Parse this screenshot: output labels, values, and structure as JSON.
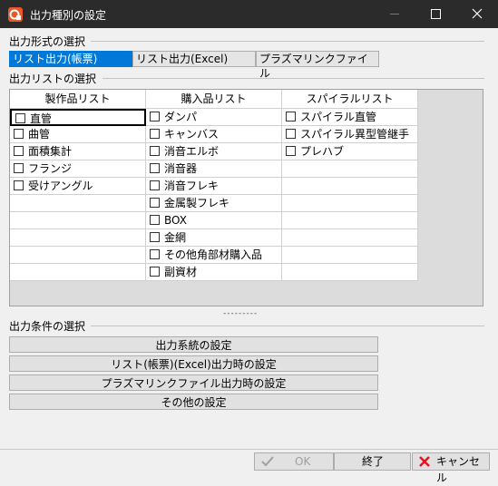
{
  "window": {
    "title": "出力種別の設定"
  },
  "output_format": {
    "heading": "出力形式の選択",
    "tabs": [
      {
        "label": "リスト出力(帳票)",
        "selected": true
      },
      {
        "label": "リスト出力(Excel)",
        "selected": false
      },
      {
        "label": "プラズマリンクファイル",
        "selected": false
      }
    ]
  },
  "output_list": {
    "heading": "出力リストの選択",
    "columns": [
      {
        "header": "製作品リスト",
        "items": [
          "直管",
          "曲管",
          "面積集計",
          "フランジ",
          "受けアングル"
        ]
      },
      {
        "header": "購入品リスト",
        "items": [
          "ダンパ",
          "キャンバス",
          "消音エルボ",
          "消音器",
          "消音フレキ",
          "金属製フレキ",
          "BOX",
          "金網",
          "その他角部材購入品",
          "副資材"
        ]
      },
      {
        "header": "スパイラルリスト",
        "items": [
          "スパイラル直管",
          "スパイラル異型管継手",
          "プレハブ"
        ]
      }
    ],
    "splitter": "---------"
  },
  "output_conditions": {
    "heading": "出力条件の選択",
    "buttons": [
      "出力系統の設定",
      "リスト(帳票)(Excel)出力時の設定",
      "プラズマリンクファイル出力時の設定",
      "その他の設定"
    ]
  },
  "footer": {
    "ok_label": "OK",
    "finish_label": "終了",
    "cancel_label": "キャンセル"
  },
  "colors": {
    "titlebar": "#2b2b2b",
    "accent": "#0078d7",
    "app_icon": "#e8572a",
    "ok_icon": "#a0a0a0",
    "cancel_icon": "#e81123"
  }
}
